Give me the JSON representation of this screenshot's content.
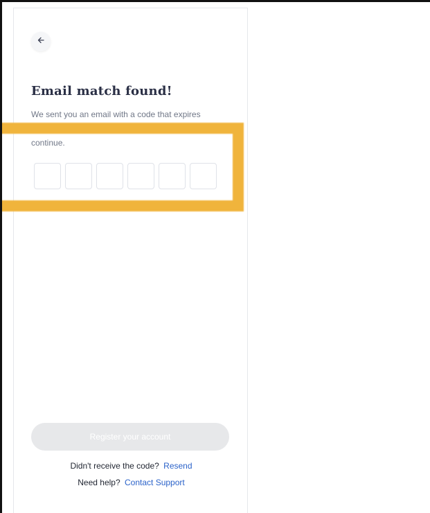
{
  "header": {
    "back_icon": "arrow-left-icon"
  },
  "main": {
    "title": "Email match found!",
    "description_line1": "We sent you an email with a code that expires",
    "description_line2": "continue.",
    "code_digits": [
      "",
      "",
      "",
      "",
      "",
      ""
    ]
  },
  "footer": {
    "register_label": "Register your account",
    "resend_prompt": "Didn't receive the code?",
    "resend_link": "Resend",
    "help_prompt": "Need help?",
    "help_link": "Contact Support"
  },
  "colors": {
    "highlight": "#f0b43c",
    "link": "#2a62c9",
    "title": "#2a2f45",
    "button_disabled": "#e7e8ea"
  }
}
